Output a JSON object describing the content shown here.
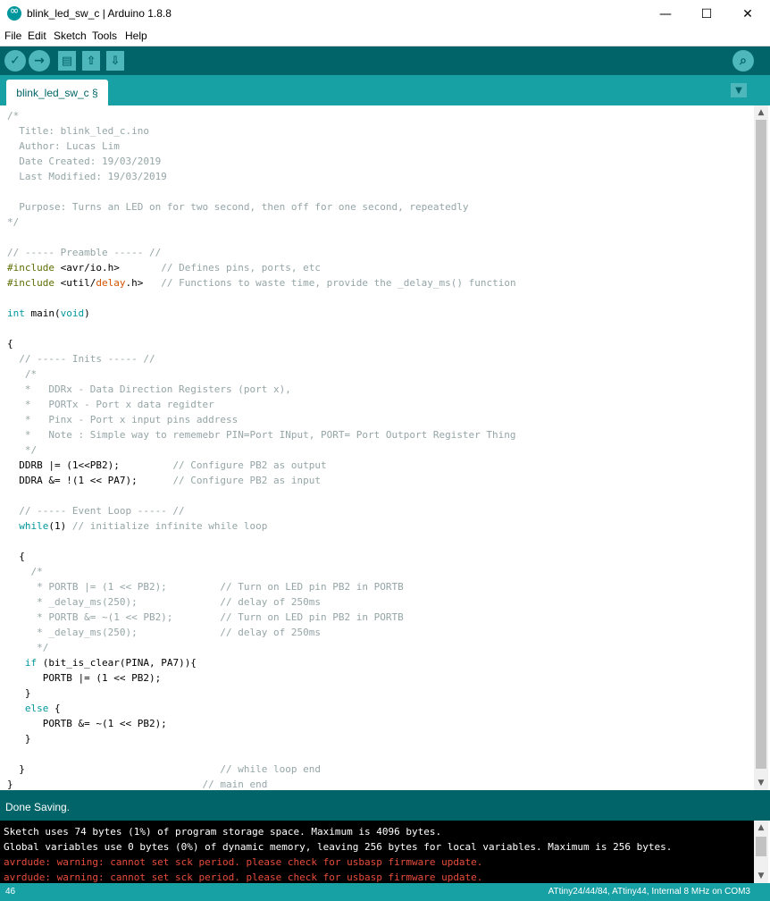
{
  "window": {
    "title": "blink_led_sw_c | Arduino 1.8.8",
    "minimize": "—",
    "maximize": "☐",
    "close": "✕"
  },
  "menu": [
    "File",
    "Edit",
    "Sketch",
    "Tools",
    "Help"
  ],
  "toolbar": {
    "verify": "✓",
    "upload": "→",
    "new": "▤",
    "open": "⇧",
    "save": "⇩",
    "serial_monitor": "⌕"
  },
  "tab": {
    "label": "blink_led_sw_c §",
    "menu": "▼"
  },
  "colors": {
    "comment": "#95a5a6",
    "keyword": "#00979c",
    "type": "#00979c",
    "preproc": "#5e6d03",
    "func": "#d35400",
    "default": "#000000"
  },
  "code": [
    [
      [
        "c",
        "/*"
      ]
    ],
    [
      [
        "c",
        "  Title: blink_led_c.ino"
      ]
    ],
    [
      [
        "c",
        "  Author: Lucas Lim"
      ]
    ],
    [
      [
        "c",
        "  Date Created: 19/03/2019"
      ]
    ],
    [
      [
        "c",
        "  Last Modified: 19/03/2019"
      ]
    ],
    [],
    [
      [
        "c",
        "  Purpose: Turns an LED on for two second, then off for one second, repeatedly"
      ]
    ],
    [
      [
        "c",
        "*/"
      ]
    ],
    [],
    [
      [
        "c",
        "// ----- Preamble ----- //"
      ]
    ],
    [
      [
        "p",
        "#include"
      ],
      [
        "d",
        " <avr/io.h>       "
      ],
      [
        "c",
        "// Defines pins, ports, etc"
      ]
    ],
    [
      [
        "p",
        "#include"
      ],
      [
        "d",
        " <util/"
      ],
      [
        "f",
        "delay"
      ],
      [
        "d",
        ".h>   "
      ],
      [
        "c",
        "// Functions to waste time, provide the _delay_ms() function"
      ]
    ],
    [],
    [
      [
        "t",
        "int"
      ],
      [
        "d",
        " main("
      ],
      [
        "t",
        "void"
      ],
      [
        "d",
        ")"
      ]
    ],
    [],
    [
      [
        "d",
        "{"
      ]
    ],
    [
      [
        "c",
        "  // ----- Inits ----- //"
      ]
    ],
    [
      [
        "c",
        "   /*"
      ]
    ],
    [
      [
        "c",
        "   *   DDRx - Data Direction Registers (port x),"
      ]
    ],
    [
      [
        "c",
        "   *   PORTx - Port x data regidter"
      ]
    ],
    [
      [
        "c",
        "   *   Pinx - Port x input pins address"
      ]
    ],
    [
      [
        "c",
        "   *   Note : Simple way to rememebr PIN=Port INput, PORT= Port Outport Register Thing"
      ]
    ],
    [
      [
        "c",
        "   */"
      ]
    ],
    [
      [
        "d",
        "  DDRB |= (1<<PB2);         "
      ],
      [
        "c",
        "// Configure PB2 as output"
      ]
    ],
    [
      [
        "d",
        "  DDRA &= !(1 << PA7);      "
      ],
      [
        "c",
        "// Configure PB2 as input"
      ]
    ],
    [],
    [
      [
        "c",
        "  // ----- Event Loop ----- //"
      ]
    ],
    [
      [
        "d",
        "  "
      ],
      [
        "k",
        "while"
      ],
      [
        "d",
        "(1) "
      ],
      [
        "c",
        "// initialize infinite while loop"
      ]
    ],
    [],
    [
      [
        "d",
        "  {"
      ]
    ],
    [
      [
        "c",
        "    /*"
      ]
    ],
    [
      [
        "c",
        "     * PORTB |= (1 << PB2);         // Turn on LED pin PB2 in PORTB"
      ]
    ],
    [
      [
        "c",
        "     * _delay_ms(250);              // delay of 250ms"
      ]
    ],
    [
      [
        "c",
        "     * PORTB &= ~(1 << PB2);        // Turn on LED pin PB2 in PORTB"
      ]
    ],
    [
      [
        "c",
        "     * _delay_ms(250);              // delay of 250ms"
      ]
    ],
    [
      [
        "c",
        "     */"
      ]
    ],
    [
      [
        "d",
        "   "
      ],
      [
        "k",
        "if"
      ],
      [
        "d",
        " (bit_is_clear(PINA, PA7)){"
      ]
    ],
    [
      [
        "d",
        "      PORTB |= (1 << PB2);"
      ]
    ],
    [
      [
        "d",
        "   }"
      ]
    ],
    [
      [
        "d",
        "   "
      ],
      [
        "k",
        "else"
      ],
      [
        "d",
        " {"
      ]
    ],
    [
      [
        "d",
        "      PORTB &= ~(1 << PB2);"
      ]
    ],
    [
      [
        "d",
        "   }"
      ]
    ],
    [],
    [
      [
        "d",
        "  }                                 "
      ],
      [
        "c",
        "// while loop end"
      ]
    ],
    [
      [
        "d",
        "}                                "
      ],
      [
        "c",
        "// main end"
      ]
    ]
  ],
  "status": "Done Saving.",
  "console": [
    {
      "text": "Sketch uses 74 bytes (1%) of program storage space. Maximum is 4096 bytes.",
      "color": "#ffffff"
    },
    {
      "text": "Global variables use 0 bytes (0%) of dynamic memory, leaving 256 bytes for local variables. Maximum is 256 bytes.",
      "color": "#ffffff"
    },
    {
      "text": "avrdude: warning: cannot set sck period. please check for usbasp firmware update.",
      "color": "#e74c3c"
    },
    {
      "text": "avrdude: warning: cannot set sck period. please check for usbasp firmware update.",
      "color": "#e74c3c"
    }
  ],
  "footer": {
    "line": "46",
    "board": "ATtiny24/44/84, ATtiny44, Internal 8 MHz on COM3"
  },
  "scroll": {
    "up": "▲",
    "down": "▼"
  }
}
